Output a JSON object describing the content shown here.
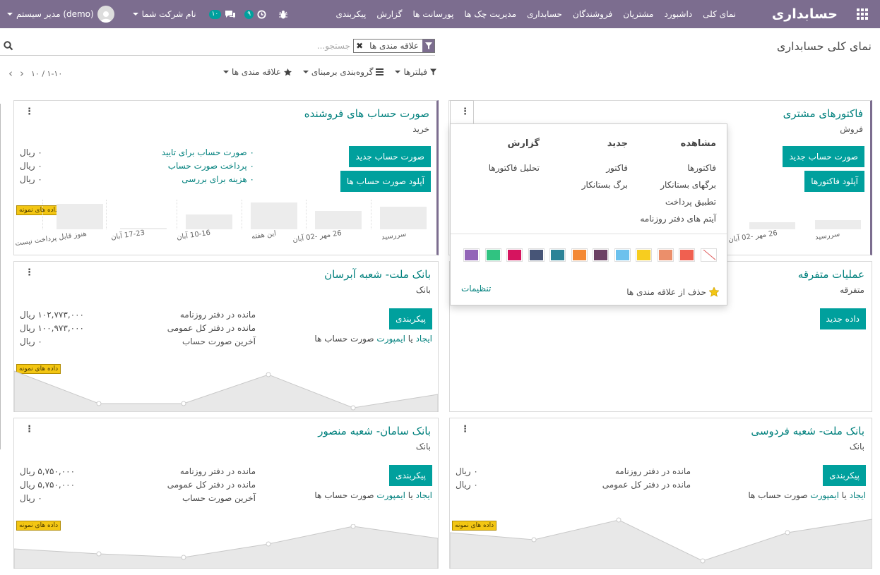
{
  "navbar": {
    "brand": "حسابداری",
    "menu": [
      "نمای کلی",
      "داشبورد",
      "مشتریان",
      "فروشندگان",
      "حسابداری",
      "مدیریت چک ها",
      "پورسانت ها",
      "گزارش",
      "پیکربندی"
    ],
    "user": "مدیر سیستم (demo)",
    "company": "نام شرکت شما",
    "messages_count": "۱۰",
    "activities_count": "۹"
  },
  "control": {
    "title": "نمای کلی حسابداری",
    "facet_label": "علاقه مندی ها",
    "search_placeholder": "جستجو...",
    "filters_label": "فیلترها",
    "groupby_label": "گروه‌بندی برمبنای",
    "favorites_label": "علاقه مندی ها",
    "pager_value": "۱-۱۰ / ۱۰"
  },
  "sample_label": "داده های نمونه",
  "cards": {
    "customer_invoices": {
      "title": "فاکتورهای مشتری",
      "subtitle": "فروش",
      "btn_new": "صورت حساب جدید",
      "btn_upload": "آپلود فاکتورها",
      "bar_labels": [
        "26 مهر -02 آبان",
        "سررسید"
      ]
    },
    "vendor_bills": {
      "title": "صورت حساب های فروشنده",
      "subtitle": "خرید",
      "btn_new": "صورت حساب جدید",
      "btn_upload": "آپلود صورت حساب ها",
      "stats": [
        {
          "label": "۰ صورت حساب برای تایید",
          "value": "۰ ریال"
        },
        {
          "label": "۰ پرداخت صورت حساب",
          "value": "۰ ریال"
        },
        {
          "label": "۰ هزینه برای بررسی",
          "value": "۰ ریال"
        }
      ],
      "bar_labels": [
        "هنوز قابل پرداخت نیست",
        "17-23 آبان",
        "10-16 آبان",
        "این هفته",
        "26 مهر -02 آبان",
        "سررسید"
      ]
    },
    "misc": {
      "title": "عملیات متفرقه",
      "subtitle": "متفرقه",
      "btn_new": "داده جدید"
    },
    "mellat_abarsan": {
      "title": "بانک ملت- شعبه آبرسان",
      "subtitle": "بانک",
      "btn_config": "پیکربندی",
      "create_text": "ایجاد",
      "or_text": "یا",
      "import_text": "ایمپورت",
      "statements_text": "صورت حساب ها",
      "stats": [
        {
          "label": "مانده در دفتر روزنامه",
          "value": "۱۰۲,۷۷۳,۰۰۰ ریال"
        },
        {
          "label": "مانده در دفتر کل عمومی",
          "value": "۱۰۰,۹۷۳,۰۰۰ ریال"
        },
        {
          "label": "آخرین صورت حساب",
          "value": "۰ ریال"
        }
      ]
    },
    "saman_mansour": {
      "title": "بانک سامان- شعبه منصور",
      "subtitle": "بانک",
      "btn_config": "پیکربندی",
      "create_text": "ایجاد",
      "or_text": "یا",
      "import_text": "ایمپورت",
      "statements_text": "صورت حساب ها",
      "stats": [
        {
          "label": "مانده در دفتر روزنامه",
          "value": "۵,۷۵۰,۰۰۰ ریال"
        },
        {
          "label": "مانده در دفتر کل عمومی",
          "value": "۵,۷۵۰,۰۰۰ ریال"
        },
        {
          "label": "آخرین صورت حساب",
          "value": "۰ ریال"
        }
      ]
    },
    "mellat_ferdowsi": {
      "title": "بانک ملت- شعبه فردوسی",
      "subtitle": "بانک",
      "btn_config": "پیکربندی",
      "create_text": "ایجاد",
      "or_text": "یا",
      "import_text": "ایمپورت",
      "statements_text": "صورت حساب ها",
      "stats": [
        {
          "label": "مانده در دفتر روزنامه",
          "value": "۰ ریال"
        },
        {
          "label": "مانده در دفتر کل عمومی",
          "value": "۰ ریال"
        }
      ]
    }
  },
  "dropdown": {
    "col_view": "مشاهده",
    "col_new": "جدید",
    "col_report": "گزارش",
    "view_items": [
      "فاکتورها",
      "برگهای بستانکار",
      "تطبیق پرداخت",
      "آیتم های دفتر روزنامه"
    ],
    "new_items": [
      "فاکتور",
      "برگ بستانکار"
    ],
    "report_items": [
      "تحلیل فاکتورها"
    ],
    "remove_fav": "حذف از علاقه مندی ها",
    "settings": "تنظیمات",
    "swatch_colors": [
      "#9365b8",
      "#30c381",
      "#d6145f",
      "#475577",
      "#2c8397",
      "#f48935",
      "#6c4164",
      "#6cc1ed",
      "#f7cd1f",
      "#eb8f6b",
      "#f06050"
    ]
  }
}
